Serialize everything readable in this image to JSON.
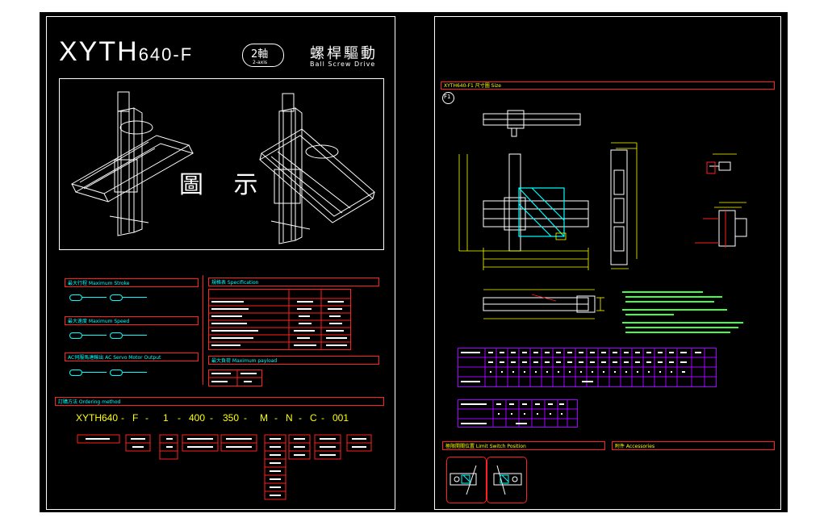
{
  "left_sheet": {
    "title_main": "XYTH",
    "title_sub": "640-F",
    "axis_badge": "2軸",
    "axis_badge_sub": "2-axis",
    "drive_cn": "螺桿驅動",
    "drive_en": "Ball Screw Drive",
    "illustration_label": "圖 示",
    "sections": {
      "max_stroke": "最大行程 Maximum Stroke",
      "max_speed": "最大速度 Maximum Speed",
      "servo_output": "AC伺服馬達輸出 AC Servo Motor Output",
      "specification": "規格表 Specification",
      "max_payload": "最大負荷 Maximum payload",
      "ordering": "訂購方法 Ordering method"
    },
    "ordering_code": [
      "XYTH640",
      "-",
      "F",
      "-",
      "1",
      "-",
      "400",
      "-",
      "350",
      "-",
      "M",
      "-",
      "N",
      "-",
      "C",
      "-",
      "001"
    ]
  },
  "right_sheet": {
    "section_title": "XYTH640-F1 尺寸圖 Size",
    "circle_label": "F1",
    "section_limit": "極限開關位置 Limit Switch Position",
    "section_accessories": "附件 Accessories"
  },
  "colors": {
    "line": "#ffffff",
    "frame": "#ff2020",
    "dimension": "#ffff00",
    "annotation": "#00ffff",
    "table_line": "#a000ff",
    "note_green": "#40ff40"
  }
}
